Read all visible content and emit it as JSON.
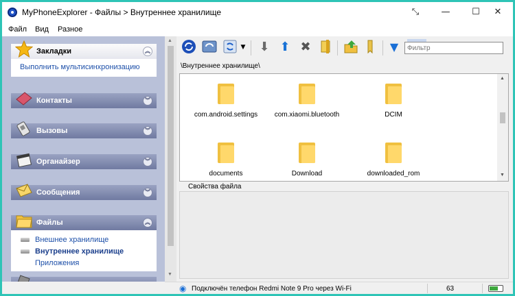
{
  "window": {
    "title": "MyPhoneExplorer -  Файлы > Внутреннее хранилище",
    "controls": {
      "resize": "⤡",
      "minimize": "—",
      "maximize": "☐",
      "close": "✕"
    }
  },
  "menu": [
    "Файл",
    "Вид",
    "Разное"
  ],
  "sidebar": {
    "bookmarks": {
      "label": "Закладки",
      "icon": "star-icon",
      "link": "Выполнить мультисинхронизацию"
    },
    "sections": [
      {
        "label": "Контакты",
        "icon": "contacts-book-icon"
      },
      {
        "label": "Вызовы",
        "icon": "phone-calls-icon"
      },
      {
        "label": "Органайзер",
        "icon": "organizer-icon"
      },
      {
        "label": "Сообщения",
        "icon": "envelope-icon"
      }
    ],
    "files": {
      "label": "Файлы",
      "icon": "folder-icon",
      "items": [
        "Внешнее хранилище",
        "Внутреннее хранилище",
        "Приложения"
      ],
      "selected": "Внутреннее хранилище"
    },
    "chevron_collapse": "︽",
    "chevron_expand": "︾"
  },
  "toolbar": {
    "icons": [
      "sync-icon",
      "refresh-icon",
      "reload-dropdown-icon",
      "download-icon",
      "upload-icon",
      "delete-icon",
      "rename-icon",
      "new-folder-icon",
      "bookmark-icon",
      "filter-icon"
    ],
    "filter_placeholder": "Фильтр",
    "colors": {
      "arrow": "#6a6a6a",
      "upload": "#1a73d6",
      "sync": "#1d4fb8",
      "filter": "#1a6fd6"
    }
  },
  "path": "\\Внутреннее хранилище\\",
  "files": [
    {
      "name": "com.android.settings"
    },
    {
      "name": "com.xiaomi.bluetooth"
    },
    {
      "name": "DCIM"
    },
    {
      "name": "documents"
    },
    {
      "name": "Download"
    },
    {
      "name": "downloaded_rom"
    }
  ],
  "properties": {
    "label": "Свойства файла"
  },
  "status": {
    "connection": "Подключён телефон Redmi Note 9 Pro через Wi-Fi",
    "number": "63",
    "battery_level": 0.65
  }
}
